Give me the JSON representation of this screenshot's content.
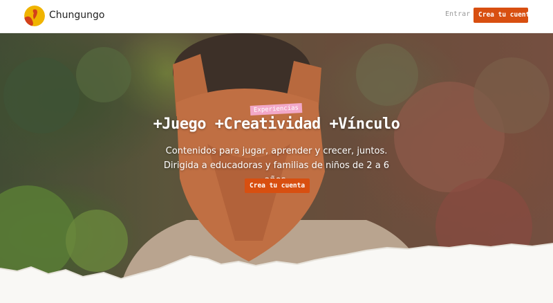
{
  "header": {
    "brand": "Chungungo",
    "login_label": "Entrar",
    "signup_label": "Crea tu cuenta"
  },
  "hero": {
    "badge": "Experiencias",
    "title": "+Juego +Creatividad +Vínculo",
    "subtitle": "Contenidos para jugar, aprender y crecer, juntos. Dirigida a educadoras y familias de niños de 2 a 6 años.",
    "cta_label": "Crea tu cuenta"
  },
  "colors": {
    "accent": "#d84f10",
    "badge": "#f2a8c8",
    "logo_primary": "#f0b400",
    "logo_secondary": "#d3401a"
  },
  "icons": {
    "logo": "chungungo-logo-icon"
  }
}
